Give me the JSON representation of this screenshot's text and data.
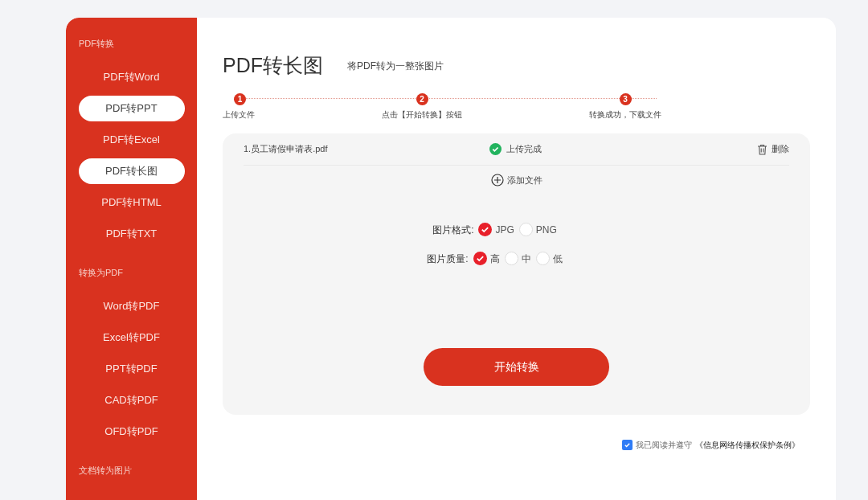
{
  "sidebar": {
    "groups": [
      {
        "title": "PDF转换",
        "items": [
          {
            "label": "PDF转Word",
            "selected": false
          },
          {
            "label": "PDF转PPT",
            "selected": true
          },
          {
            "label": "PDF转Excel",
            "selected": false
          },
          {
            "label": "PDF转长图",
            "selected": true
          },
          {
            "label": "PDF转HTML",
            "selected": false
          },
          {
            "label": "PDF转TXT",
            "selected": false
          }
        ]
      },
      {
        "title": "转换为PDF",
        "items": [
          {
            "label": "Word转PDF",
            "selected": false
          },
          {
            "label": "Excel转PDF",
            "selected": false
          },
          {
            "label": "PPT转PDF",
            "selected": false
          },
          {
            "label": "CAD转PDF",
            "selected": false
          },
          {
            "label": "OFD转PDF",
            "selected": false
          }
        ]
      },
      {
        "title": "文档转为图片"
      }
    ]
  },
  "header": {
    "title": "PDF转长图",
    "subtitle": "将PDF转为一整张图片"
  },
  "steps": [
    {
      "number": "1",
      "label": "上传文件"
    },
    {
      "number": "2",
      "label": "点击【开始转换】按钮"
    },
    {
      "number": "3",
      "label": "转换成功，下载文件"
    }
  ],
  "file": {
    "name": "1.员工请假申请表.pdf",
    "status": "上传完成",
    "delete": "删除"
  },
  "add_file": "添加文件",
  "options": [
    {
      "label": "图片格式:",
      "choices": [
        {
          "label": "JPG",
          "selected": true
        },
        {
          "label": "PNG",
          "selected": false
        }
      ]
    },
    {
      "label": "图片质量:",
      "choices": [
        {
          "label": "高",
          "selected": true
        },
        {
          "label": "中",
          "selected": false
        },
        {
          "label": "低",
          "selected": false
        }
      ]
    }
  ],
  "start_button": "开始转换",
  "agreement": {
    "checked": true,
    "text": "我已阅读并遵守",
    "link": "《信息网络传播权保护条例》"
  }
}
